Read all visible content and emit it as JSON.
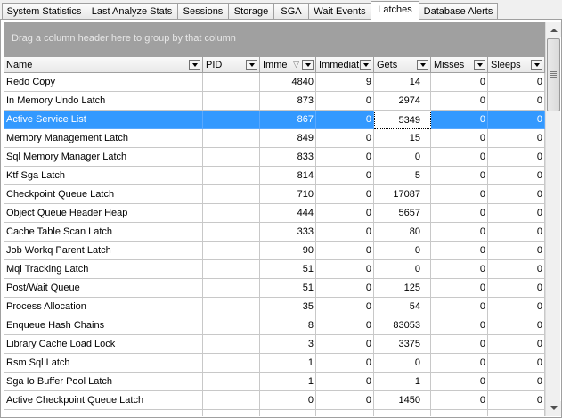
{
  "tabs": [
    {
      "label": "System Statistics",
      "active": false
    },
    {
      "label": "Last Analyze Stats",
      "active": false
    },
    {
      "label": "Sessions",
      "active": false
    },
    {
      "label": "Storage",
      "active": false
    },
    {
      "label": "SGA",
      "active": false
    },
    {
      "label": "Wait Events",
      "active": false
    },
    {
      "label": "Latches",
      "active": true
    },
    {
      "label": "Database Alerts",
      "active": false
    }
  ],
  "group_panel_text": "Drag a column header here to group by that column",
  "columns": [
    "Name",
    "PID",
    "Imme",
    "Immediat",
    "Gets",
    "Misses",
    "Sleeps"
  ],
  "sorted_column_icon": "sort-descending-icon",
  "selected_row_index": 2,
  "rows": [
    [
      "Redo Copy",
      "",
      "4840",
      "9",
      "14",
      "0",
      "0"
    ],
    [
      "In Memory Undo Latch",
      "",
      "873",
      "0",
      "2974",
      "0",
      "0"
    ],
    [
      "Active Service List",
      "",
      "867",
      "0",
      "5349",
      "0",
      "0"
    ],
    [
      "Memory Management Latch",
      "",
      "849",
      "0",
      "15",
      "0",
      "0"
    ],
    [
      "Sql Memory Manager Latch",
      "",
      "833",
      "0",
      "0",
      "0",
      "0"
    ],
    [
      "Ktf Sga Latch",
      "",
      "814",
      "0",
      "5",
      "0",
      "0"
    ],
    [
      "Checkpoint Queue Latch",
      "",
      "710",
      "0",
      "17087",
      "0",
      "0"
    ],
    [
      "Object Queue Header Heap",
      "",
      "444",
      "0",
      "5657",
      "0",
      "0"
    ],
    [
      "Cache Table Scan Latch",
      "",
      "333",
      "0",
      "80",
      "0",
      "0"
    ],
    [
      "Job Workq Parent Latch",
      "",
      "90",
      "0",
      "0",
      "0",
      "0"
    ],
    [
      "Mql Tracking Latch",
      "",
      "51",
      "0",
      "0",
      "0",
      "0"
    ],
    [
      "Post/Wait Queue",
      "",
      "51",
      "0",
      "125",
      "0",
      "0"
    ],
    [
      "Process Allocation",
      "",
      "35",
      "0",
      "54",
      "0",
      "0"
    ],
    [
      "Enqueue Hash Chains",
      "",
      "8",
      "0",
      "83053",
      "0",
      "0"
    ],
    [
      "Library Cache Load Lock",
      "",
      "3",
      "0",
      "3375",
      "0",
      "0"
    ],
    [
      "Rsm Sql Latch",
      "",
      "1",
      "0",
      "0",
      "0",
      "0"
    ],
    [
      "Sga Io Buffer Pool Latch",
      "",
      "1",
      "0",
      "1",
      "0",
      "0"
    ],
    [
      "Active Checkpoint Queue Latch",
      "",
      "0",
      "0",
      "1450",
      "0",
      "0"
    ],
    [
      "",
      "",
      "",
      "",
      "",
      "",
      ""
    ]
  ]
}
